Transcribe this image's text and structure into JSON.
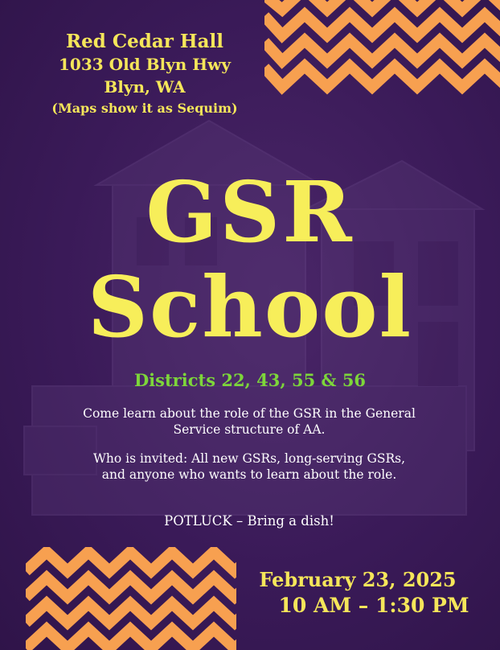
{
  "venue": {
    "name": "Red Cedar Hall",
    "street": "1033 Old Blyn Hwy",
    "city": "Blyn, WA",
    "note": "(Maps show it as Sequim)"
  },
  "title": {
    "line1": "GSR",
    "line2": "School"
  },
  "districts": "Districts 22, 43, 55 & 56",
  "description": {
    "p1": "Come learn about the role of the GSR in the General Service structure of AA.",
    "p2": "Who is invited: All new GSRs, long-serving GSRs, and anyone who wants to learn about the role.",
    "p3": "POTLUCK – Bring a dish!"
  },
  "event": {
    "date": "February 23, 2025",
    "time": "10 AM – 1:30 PM"
  },
  "colors": {
    "background": "#3d1c5c",
    "title": "#f7ee5a",
    "districts": "#7dd63a",
    "chevron": "#f7a050"
  }
}
